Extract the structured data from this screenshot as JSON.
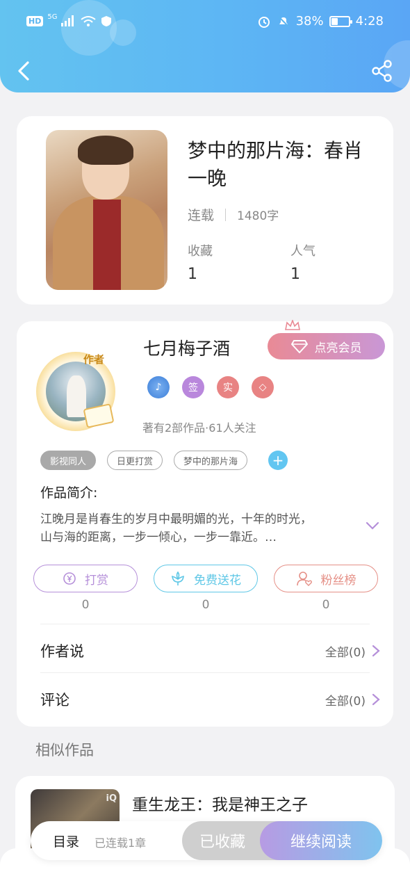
{
  "status_bar": {
    "network_badge": "HD",
    "signal_label": "5G",
    "battery_percent": "38%",
    "time": "4:28"
  },
  "book": {
    "title": "梦中的那片海：春肖一晚",
    "status": "连载",
    "word_count": "1480字",
    "favorites_label": "收藏",
    "favorites_value": "1",
    "popularity_label": "人气",
    "popularity_value": "1"
  },
  "author": {
    "avatar_badge": "作者",
    "name": "七月梅子酒",
    "vip_button": "点亮会员",
    "medals": [
      "♪",
      "签",
      "实",
      "◇"
    ],
    "stats": "著有2部作品·61人关注",
    "tags": [
      "影视同人",
      "日更打赏",
      "梦中的那片海"
    ],
    "add_tag": "+"
  },
  "intro": {
    "label": "作品简介:",
    "line1": "江晚月是肖春生的岁月中最明媚的光，十年的时光，",
    "line2": "山与海的距离，一步一倾心，一步一靠近。…"
  },
  "actions": {
    "tip_label": "打赏",
    "tip_count": "0",
    "flower_label": "免费送花",
    "flower_count": "0",
    "fans_label": "粉丝榜",
    "fans_count": "0"
  },
  "rows": {
    "author_says": "作者说",
    "author_says_all": "全部(0)",
    "comments": "评论",
    "comments_all": "全部(0)"
  },
  "similar": {
    "section_title": "相似作品",
    "item_title": "重生龙王：我是神王之子",
    "cover_mark": "iQ"
  },
  "bottom": {
    "toc": "目录",
    "toc_sub": "已连载1章",
    "favorited": "已收藏",
    "continue": "继续阅读"
  },
  "colors": {
    "header_start": "#63c3f0",
    "header_end": "#5aa6f5",
    "tip_purple": "#b58fd9",
    "flower_cyan": "#5ec7e6",
    "fans_red": "#e58f86"
  }
}
